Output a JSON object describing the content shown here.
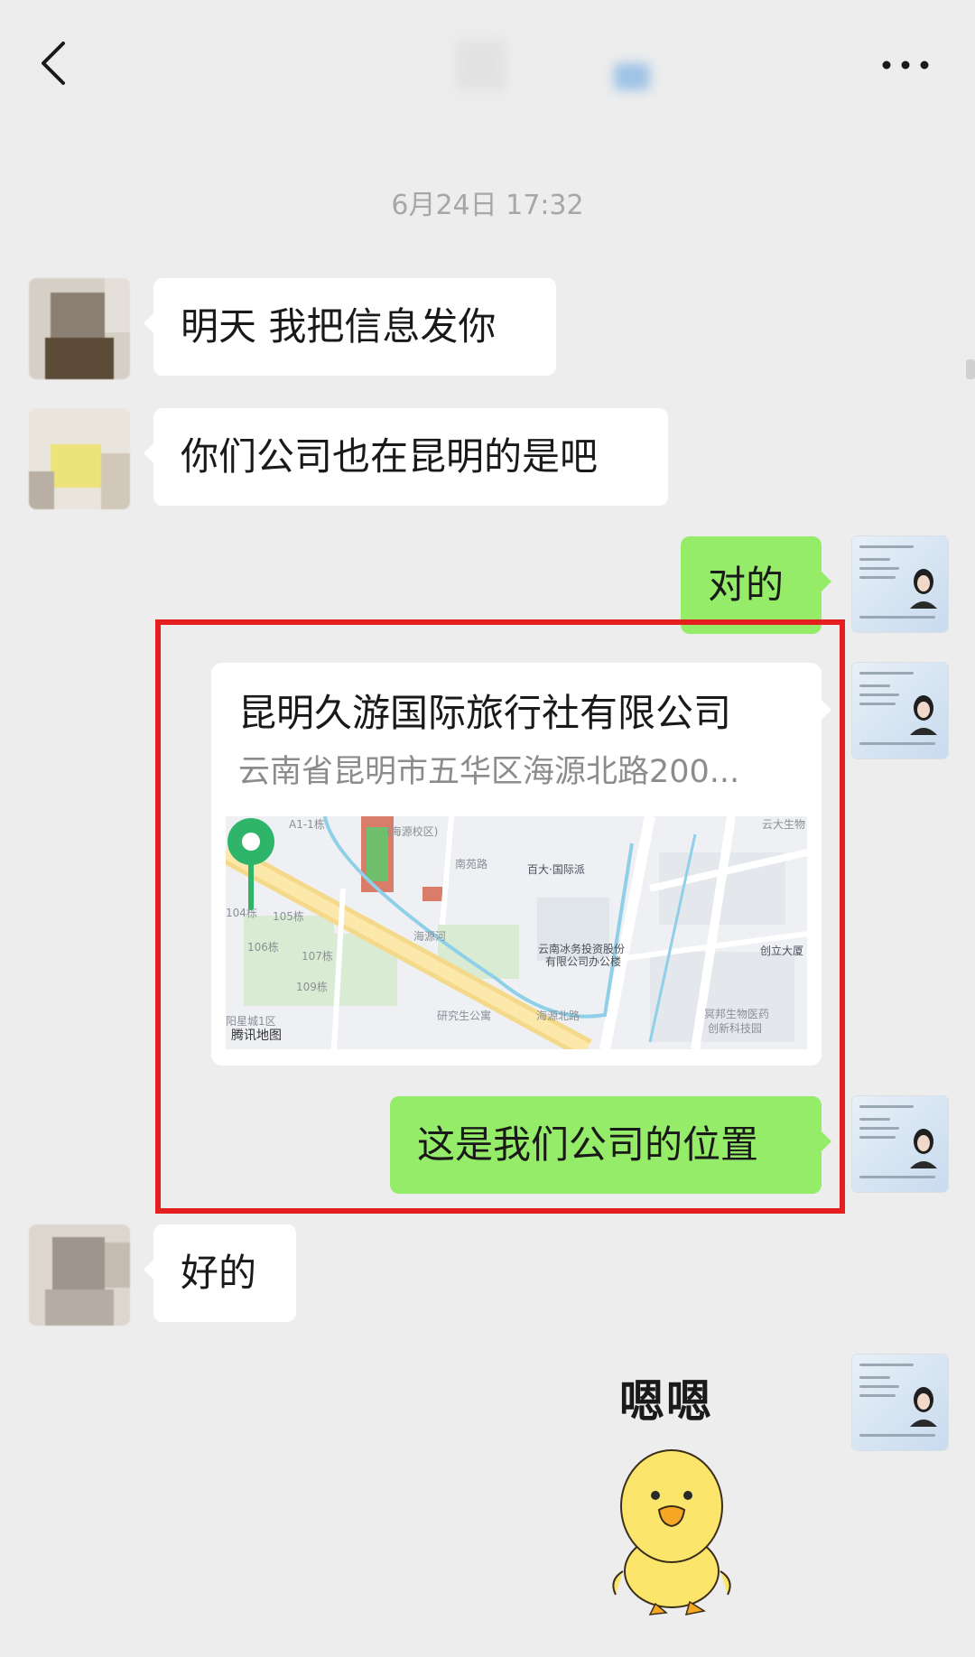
{
  "header": {
    "back_icon": "chevron-left-icon",
    "more_icon": "more-dots-icon"
  },
  "timestamp": "6月24日 17:32",
  "messages": [
    {
      "side": "in",
      "text": "明天 我把信息发你"
    },
    {
      "side": "in",
      "text": "你们公司也在昆明的是吧"
    },
    {
      "side": "out",
      "text": "对的"
    },
    {
      "side": "out",
      "type": "location",
      "name": "昆明久游国际旅行社有限公司",
      "address": "云南省昆明市五华区海源北路200...",
      "map": {
        "brand": "腾讯地图",
        "labels": [
          "A1-1栋",
          "(海源校区)",
          "南苑路",
          "百大·国际派",
          "云大生物",
          "104栋",
          "105栋",
          "106栋",
          "107栋",
          "109栋",
          "海源河",
          "云南冰务投资股份",
          "有限公司办公楼",
          "创立大厦",
          "阳星城1区",
          "研究生公寓",
          "海源北路",
          "冥邦生物医药",
          "创新科技园"
        ]
      }
    },
    {
      "side": "out",
      "text": "这是我们公司的位置"
    },
    {
      "side": "in",
      "text": "好的"
    },
    {
      "side": "out",
      "type": "sticker",
      "text": "嗯嗯"
    }
  ],
  "colors": {
    "background": "#ededed",
    "out_bubble": "#95ec69",
    "in_bubble": "#ffffff",
    "highlight_frame": "#e51f1f",
    "map_pin": "#2fb56a"
  }
}
